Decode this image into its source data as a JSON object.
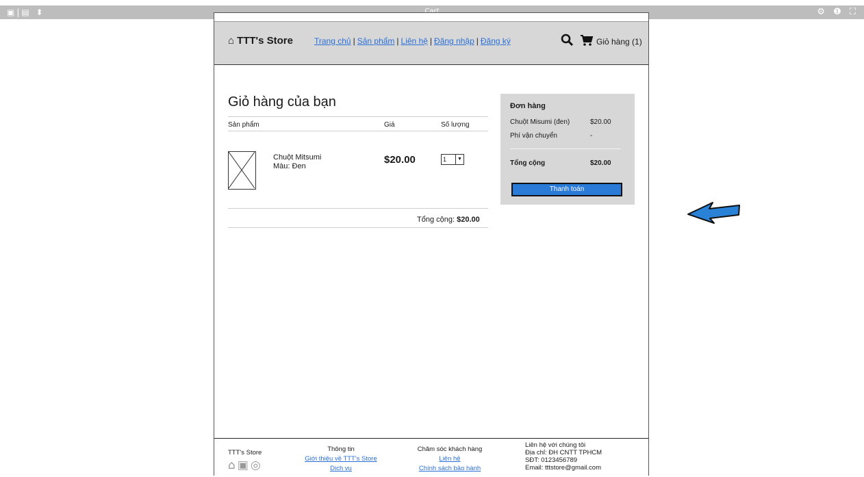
{
  "editor": {
    "window_title": "Cart"
  },
  "header": {
    "logo": "TTT's Store",
    "nav": [
      "Trang chủ",
      "Sản phẩm",
      "Liên hệ",
      "Đăng nhập",
      "Đăng ký"
    ],
    "cart_label": "Giỏ hàng (1)"
  },
  "cart": {
    "title": "Giỏ hàng của bạn",
    "col_product": "Sản phẩm",
    "col_price": "Giá",
    "col_qty": "Số lượng",
    "item": {
      "name": "Chuột Mitsumi",
      "color": "Màu: Đen",
      "price": "$20.00",
      "qty": "1"
    },
    "total_label": "Tổng cộng: ",
    "total_value": "$20.00"
  },
  "order": {
    "title": "Đơn hàng",
    "item_label": "Chuột Misumi (đen)",
    "item_value": "$20.00",
    "ship_label": "Phí vận chuyển",
    "ship_value": "-",
    "total_label": "Tổng cộng",
    "total_value": "$20.00",
    "pay_button": "Thanh toán"
  },
  "footer": {
    "brand": "TTT's Store",
    "info_title": "Thông tin",
    "info_link1": "Giới thiệu về TTT's Store",
    "info_link2": "Dịch vụ",
    "care_title": "Chăm sóc khách hàng",
    "care_link1": "Liên hệ",
    "care_link2": "Chính sách bảo hành",
    "contact_title": "Liên hệ với chúng tôi",
    "address": "Địa chỉ: ĐH CNTT TPHCM",
    "phone": "SĐT: 0123456789",
    "email": "Email: tttstore@gmail.com"
  },
  "colors": {
    "link": "#2a6fd8",
    "accent": "#2a7ad8",
    "arrow": "#2a82d6",
    "panel": "#d7d7d7"
  },
  "icons": [
    "home-icon",
    "search-icon",
    "cart-icon",
    "facebook-icon",
    "instagram-icon",
    "gear-icon",
    "info-icon",
    "fullscreen-icon"
  ]
}
